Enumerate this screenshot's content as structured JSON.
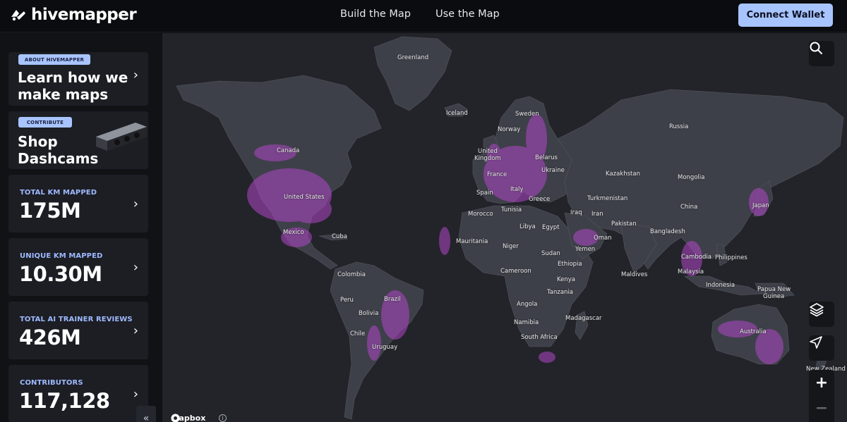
{
  "header": {
    "logo_text": "hivemapper",
    "nav": [
      "Build the Map",
      "Use the Map"
    ],
    "connect_label": "Connect Wallet"
  },
  "sidebar": {
    "promo_about": {
      "tag": "ABOUT HIVEMAPPER",
      "title_line1": "Learn how we",
      "title_line2": "make maps",
      "chevron": "›"
    },
    "promo_shop": {
      "tag": "CONTRIBUTE",
      "title_line1": "Shop",
      "title_line2": "Dashcams",
      "chevron": "›"
    },
    "stats": [
      {
        "label": "TOTAL KM MAPPED",
        "value": "175M",
        "chevron": "›"
      },
      {
        "label": "UNIQUE KM MAPPED",
        "value": "10.30M",
        "chevron": "›"
      },
      {
        "label": "TOTAL AI TRAINER REVIEWS",
        "value": "426M",
        "chevron": "›"
      },
      {
        "label": "CONTRIBUTORS",
        "value": "117,128",
        "chevron": "›"
      }
    ],
    "collapse_label": "«"
  },
  "map": {
    "attribution": "mapbox",
    "info_label": "i",
    "zoom_in": "+",
    "zoom_out": "−",
    "labels": {
      "greenland": "Greenland",
      "iceland": "Iceland",
      "sweden": "Sweden",
      "norway": "Norway",
      "russia": "Russia",
      "canada": "Canada",
      "united_kingdom_1": "United",
      "united_kingdom_2": "Kingdom",
      "belarus": "Belarus",
      "france": "France",
      "ukraine": "Ukraine",
      "kazakhstan": "Kazakhstan",
      "mongolia": "Mongolia",
      "united_states": "United States",
      "spain": "Spain",
      "italy": "Italy",
      "turkmenistan": "Turkmenistan",
      "greece": "Greece",
      "china": "China",
      "japan": "Japan",
      "morocco": "Morocco",
      "tunisia": "Tunisia",
      "iraq": "Iraq",
      "iran": "Iran",
      "mexico": "Mexico",
      "cuba": "Cuba",
      "libya": "Libya",
      "egypt": "Egypt",
      "pakistan": "Pakistan",
      "bangladesh": "Bangladesh",
      "oman": "Oman",
      "mauritania": "Mauritania",
      "niger": "Niger",
      "sudan": "Sudan",
      "yemen": "Yemen",
      "cambodia": "Cambodia",
      "philippines": "Philippines",
      "ethiopia": "Ethiopia",
      "maldives": "Maldives",
      "malaysia": "Malaysia",
      "cameroon": "Cameroon",
      "colombia": "Colombia",
      "kenya": "Kenya",
      "indonesia": "Indonesia",
      "papua_1": "Papua New",
      "papua_2": "Guinea",
      "tanzania": "Tanzania",
      "peru": "Peru",
      "brazil": "Brazil",
      "bolivia": "Bolivia",
      "angola": "Angola",
      "madagascar": "Madagascar",
      "namibia": "Namibia",
      "chile": "Chile",
      "south_africa": "South Africa",
      "australia": "Australia",
      "uruguay": "Uruguay",
      "new_zealand": "New Zealand"
    },
    "colors": {
      "ocean": "#232429",
      "land": "#3e4049",
      "coverage": "#b046c8"
    }
  }
}
